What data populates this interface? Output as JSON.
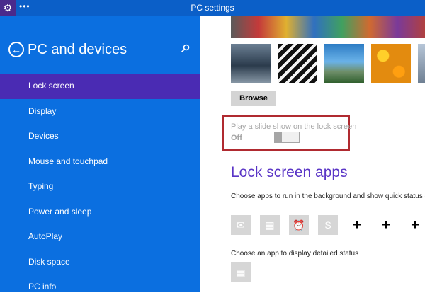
{
  "window": {
    "title": "PC settings",
    "title_dots": "•••"
  },
  "sidebar": {
    "title": "PC and devices",
    "items": [
      {
        "label": "Lock screen",
        "active": true
      },
      {
        "label": "Display"
      },
      {
        "label": "Devices"
      },
      {
        "label": "Mouse and touchpad"
      },
      {
        "label": "Typing"
      },
      {
        "label": "Power and sleep"
      },
      {
        "label": "AutoPlay"
      },
      {
        "label": "Disk space"
      },
      {
        "label": "PC info"
      }
    ]
  },
  "lock_screen": {
    "browse_label": "Browse",
    "slideshow_label": "Play a slide show on the lock screen",
    "slideshow_state": "Off",
    "slideshow_on": false
  },
  "lock_apps": {
    "heading": "Lock screen apps",
    "description": "Choose apps to run in the background and show quick status even when your screen is locked",
    "slots": [
      "mail-icon",
      "calendar-icon",
      "alarm-icon",
      "skype-icon",
      "plus-icon",
      "plus-icon",
      "plus-icon"
    ],
    "detail_description": "Choose an app to display detailed status",
    "detail_slot": "calendar-icon"
  },
  "colors": {
    "titlebar": "#0b5fc8",
    "sidebar": "#0b6fe0",
    "active_item": "#4a2bb3",
    "heading": "#5a35c6",
    "highlight": "#b02a30"
  }
}
